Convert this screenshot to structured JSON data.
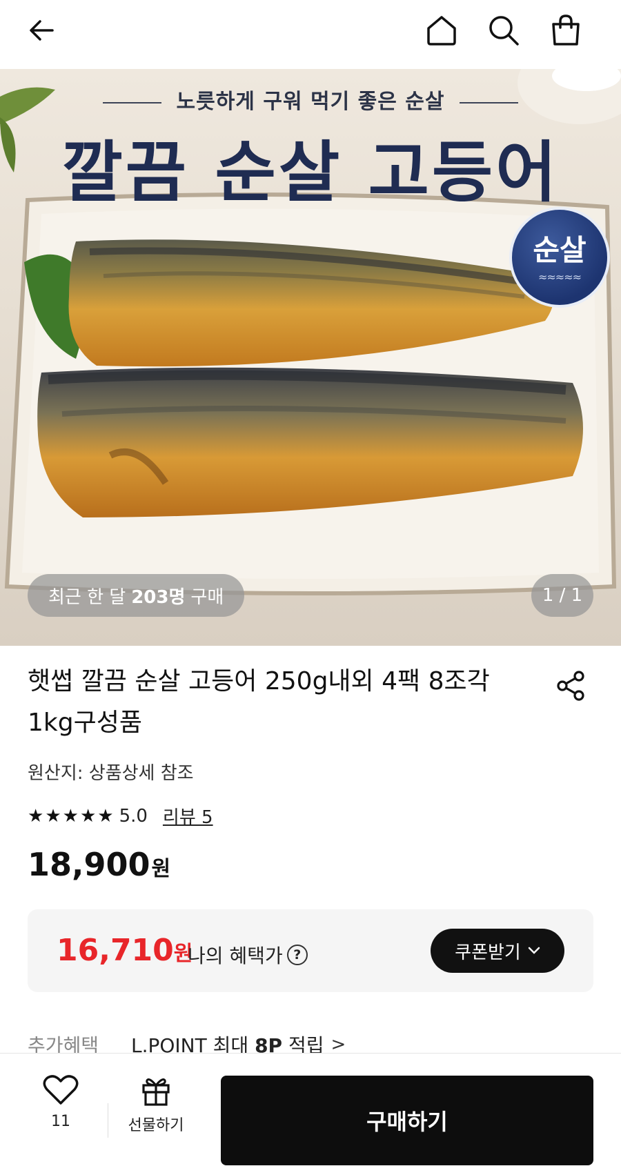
{
  "topbar": {
    "icons": [
      "back-arrow-icon",
      "home-icon",
      "search-icon",
      "shopping-bag-icon"
    ]
  },
  "hero": {
    "tagline": "노릇하게 구워 먹기 좋은 순살",
    "title": "깔끔 순살 고등어",
    "badge": "순살",
    "recent_prefix": "최근 한 달",
    "recent_count": "203명",
    "recent_suffix": "구매",
    "page_indicator": "1 / 1"
  },
  "product": {
    "title": "햇썹 깔끔 순살 고등어 250g내외 4팩 8조각 1kg구성품",
    "origin": "원산지: 상품상세 참조",
    "rating": "5.0",
    "stars": 5,
    "review_link": "리뷰 5",
    "price": "18,900",
    "price_unit": "원"
  },
  "benefit": {
    "price": "16,710",
    "price_unit": "원",
    "label": "나의 혜택가",
    "help": "?",
    "coupon_button": "쿠폰받기",
    "accent_color": "#e8262a"
  },
  "extra": {
    "label": "추가혜택",
    "value_prefix": "L.POINT 최대",
    "value_bold": "8P",
    "value_suffix": "적립",
    "chevron": ">"
  },
  "bottombar": {
    "wish_count": "11",
    "gift_label": "선물하기",
    "buy_label": "구매하기"
  }
}
